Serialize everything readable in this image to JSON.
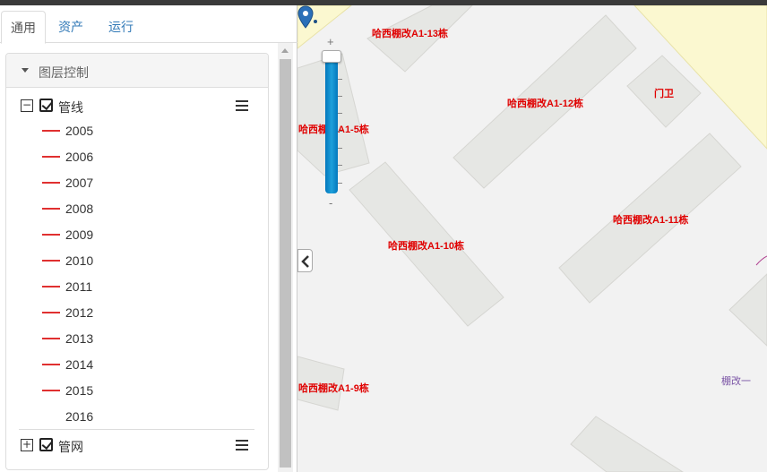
{
  "tabs": [
    {
      "label": "通用",
      "active": true
    },
    {
      "label": "资产",
      "active": false
    },
    {
      "label": "运行",
      "active": false
    }
  ],
  "layer_panel": {
    "title": "图层控制",
    "group_pipeline": {
      "label": "管线",
      "expanded": true,
      "checked": true
    },
    "years": [
      {
        "label": "2005",
        "color": "#e03030"
      },
      {
        "label": "2006",
        "color": "#e03030"
      },
      {
        "label": "2007",
        "color": "#e03030"
      },
      {
        "label": "2008",
        "color": "#e03030"
      },
      {
        "label": "2009",
        "color": "#e03030"
      },
      {
        "label": "2010",
        "color": "#e03030"
      },
      {
        "label": "2011",
        "color": "#e03030"
      },
      {
        "label": "2012",
        "color": "#e03030"
      },
      {
        "label": "2013",
        "color": "#e03030"
      },
      {
        "label": "2014",
        "color": "#e03030"
      },
      {
        "label": "2015",
        "color": "#e03030"
      },
      {
        "label": "2016",
        "color": null
      }
    ],
    "group_network": {
      "label": "管网",
      "expanded": false,
      "checked": true
    }
  },
  "map": {
    "zoom_in_label": "+",
    "zoom_out_label": "-",
    "labels": [
      {
        "text": "哈西棚改A1-13栋",
        "color": "#e00000"
      },
      {
        "text": "哈西棚改A1-12栋",
        "color": "#e00000"
      },
      {
        "text": "门卫",
        "color": "#e00000"
      },
      {
        "text": "哈西棚改A1-5栋",
        "color": "#e00000"
      },
      {
        "text": "哈西棚改A1-11栋",
        "color": "#e00000"
      },
      {
        "text": "哈西棚改A1-10栋",
        "color": "#e00000"
      },
      {
        "text": "哈西棚改A1-9栋",
        "color": "#e00000"
      },
      {
        "text": "棚改一",
        "color": "#7b55a6"
      }
    ],
    "building_color": "#e6e7e4",
    "road_color": "#fbf8d0"
  }
}
